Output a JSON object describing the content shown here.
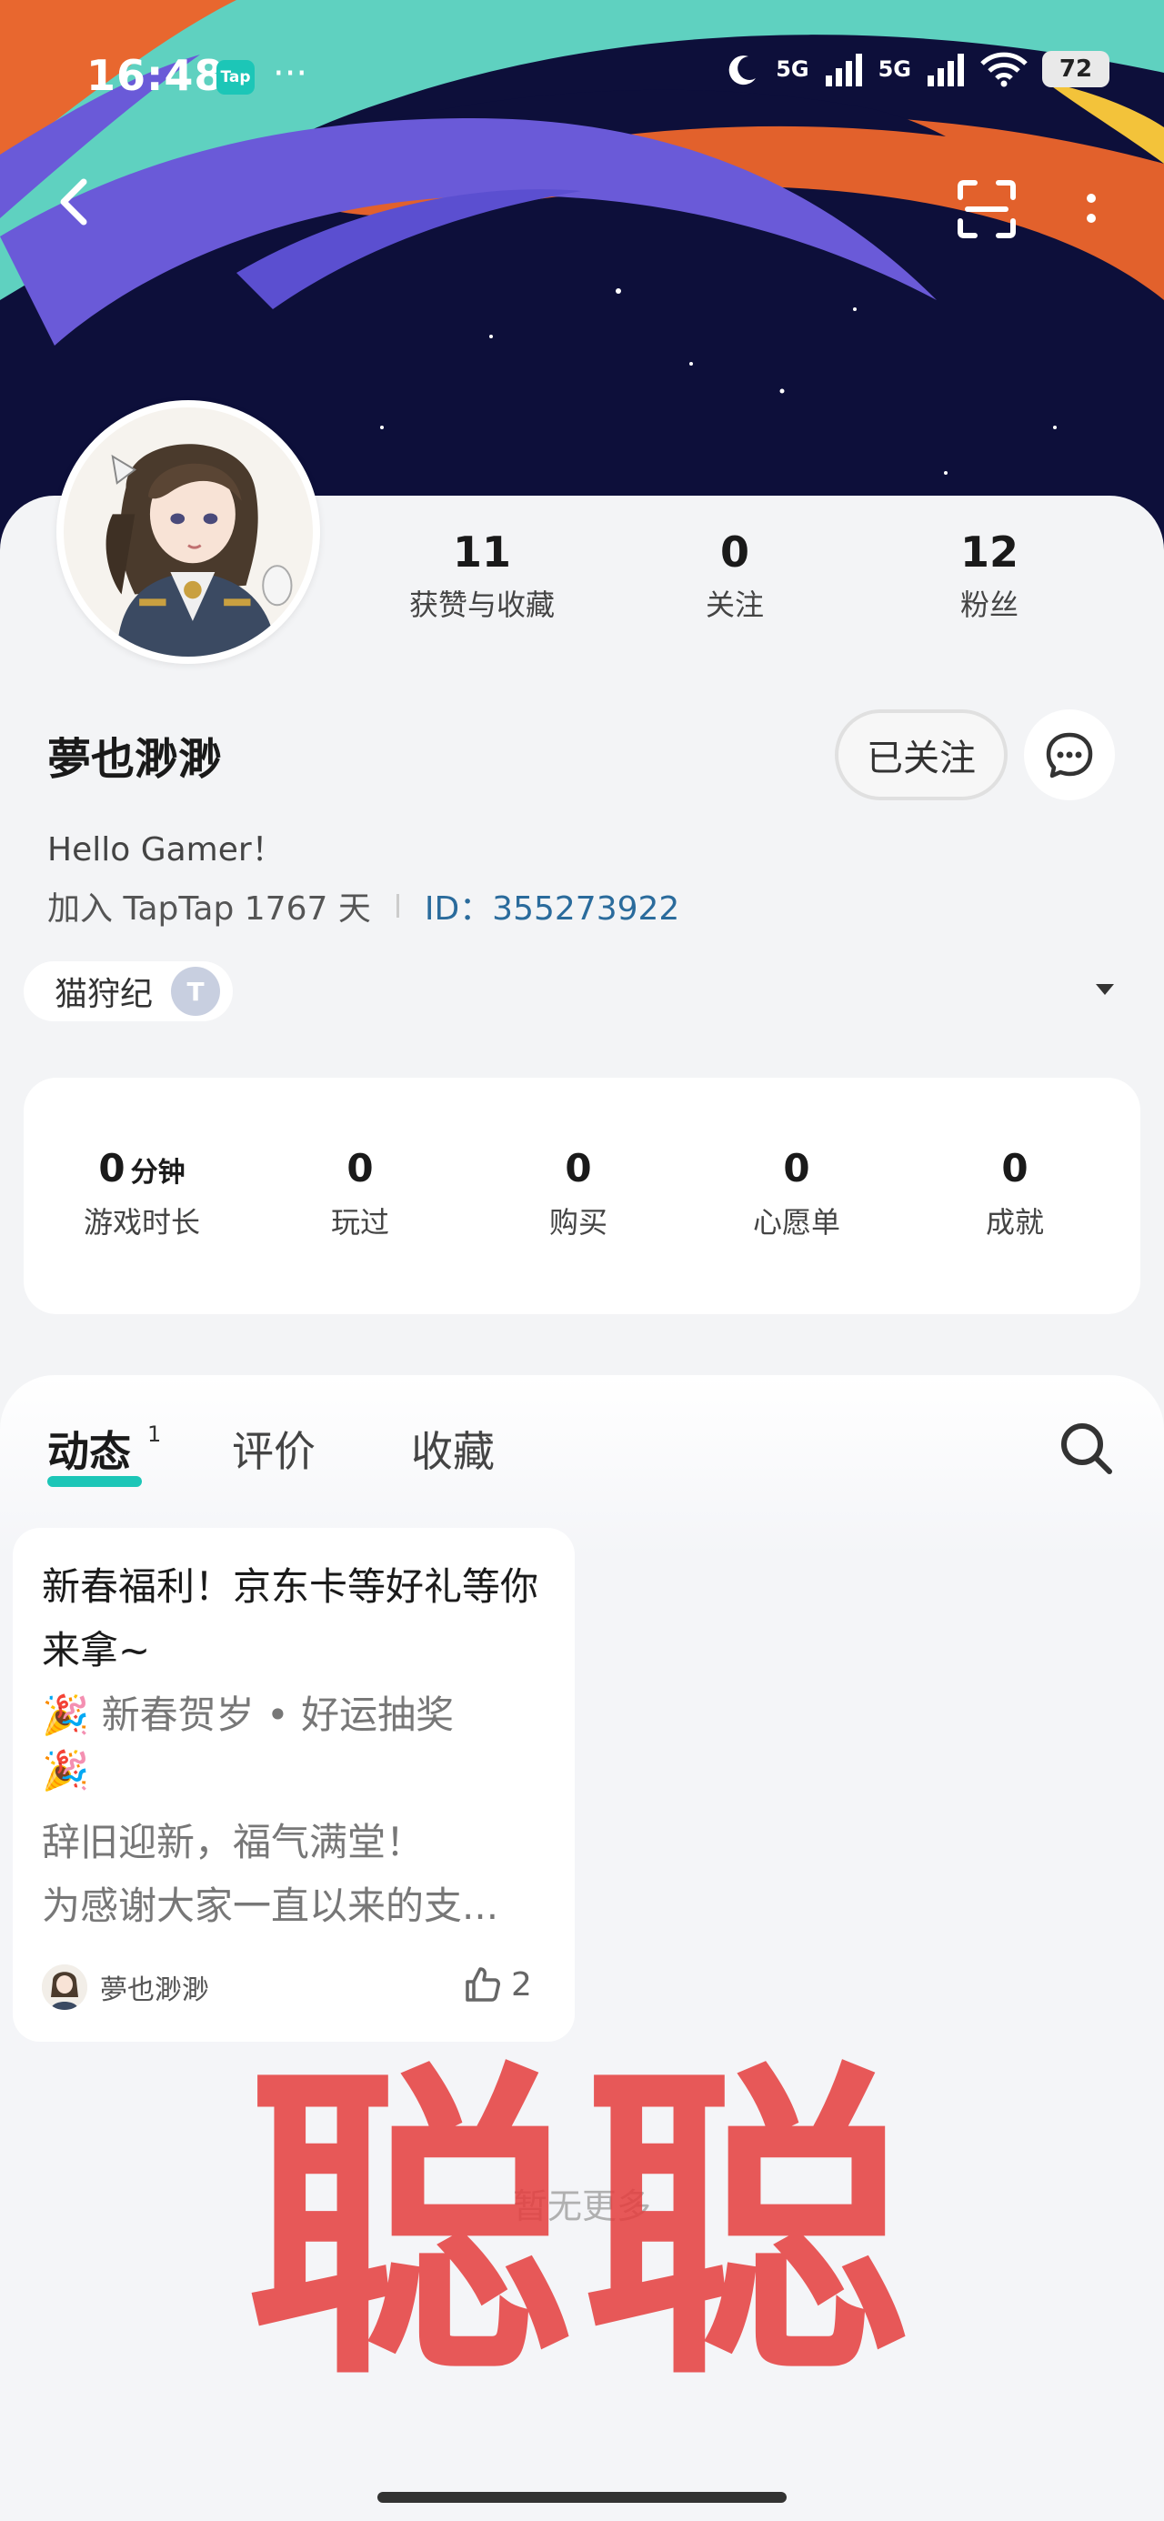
{
  "status_bar": {
    "time": "16:48",
    "app_badge": "Tap",
    "more_dots": "···",
    "net1": "5G",
    "net2": "5G",
    "battery": "72"
  },
  "colors": {
    "accent": "#1cc6b7",
    "id_link": "#2a6b9c",
    "watermark": "#e53d3d"
  },
  "profile": {
    "stats": [
      {
        "value": "11",
        "label": "获赞与收藏"
      },
      {
        "value": "0",
        "label": "关注"
      },
      {
        "value": "12",
        "label": "粉丝"
      }
    ],
    "username": "夢也渺渺",
    "follow_label": "已关注",
    "bio": "Hello Gamer！",
    "join_text": "加入 TapTap 1767 天",
    "id_text": "ID：355273922",
    "guild_name": "猫狩纪",
    "guild_badge": "T"
  },
  "game_stats": [
    {
      "value": "0",
      "unit": "分钟",
      "label": "游戏时长"
    },
    {
      "value": "0",
      "unit": "",
      "label": "玩过"
    },
    {
      "value": "0",
      "unit": "",
      "label": "购买"
    },
    {
      "value": "0",
      "unit": "",
      "label": "心愿单"
    },
    {
      "value": "0",
      "unit": "",
      "label": "成就"
    }
  ],
  "tabs": [
    {
      "label": "动态",
      "badge": "1"
    },
    {
      "label": "评价"
    },
    {
      "label": "收藏"
    }
  ],
  "post": {
    "title": "新春福利！京东卡等好礼等你来拿~",
    "line1": "🎉 新春贺岁 • 好运抽奖",
    "line2": "🎉",
    "line3": "辞旧迎新，福气满堂！",
    "line4": "为感谢大家一直以来的支...",
    "author": "夢也渺渺",
    "likes": "2"
  },
  "footer": {
    "no_more": "暂无更多",
    "watermark": "聪聪"
  }
}
